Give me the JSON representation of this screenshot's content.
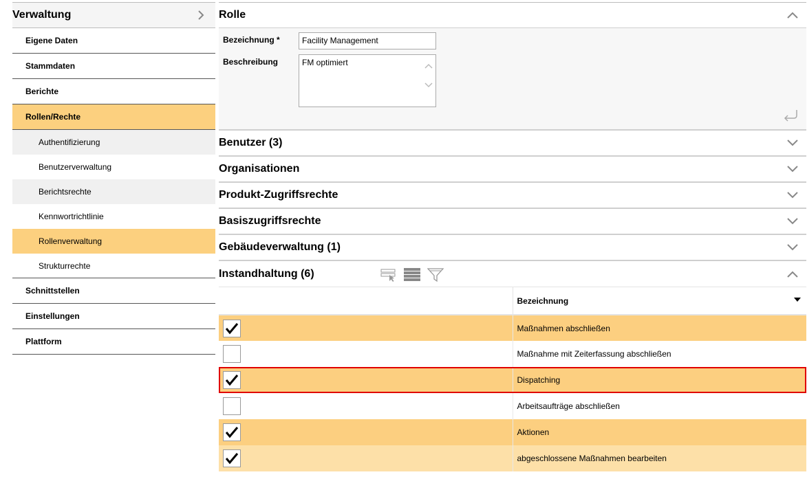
{
  "sidebar": {
    "title": "Verwaltung",
    "items": [
      {
        "label": "Eigene Daten"
      },
      {
        "label": "Stammdaten"
      },
      {
        "label": "Berichte"
      },
      {
        "label": "Rollen/Rechte"
      }
    ],
    "sub_items": [
      {
        "label": "Authentifizierung"
      },
      {
        "label": "Benutzerverwaltung"
      },
      {
        "label": "Berichtsrechte"
      },
      {
        "label": "Kennwortrichtlinie"
      },
      {
        "label": "Rollenverwaltung"
      },
      {
        "label": "Strukturrechte"
      }
    ],
    "items_after": [
      {
        "label": "Schnittstellen"
      },
      {
        "label": "Einstellungen"
      },
      {
        "label": "Plattform"
      }
    ]
  },
  "rolle": {
    "title": "Rolle",
    "bezeichnung_label": "Bezeichnung *",
    "bezeichnung_value": "Facility Management",
    "beschreibung_label": "Beschreibung",
    "beschreibung_value": "FM optimiert"
  },
  "sections": [
    {
      "title": "Benutzer (3)"
    },
    {
      "title": "Organisationen"
    },
    {
      "title": "Produkt-Zugriffsrechte"
    },
    {
      "title": "Basiszugriffsrechte"
    },
    {
      "title": "Gebäudeverwaltung (1)"
    }
  ],
  "instandhaltung": {
    "title": "Instandhaltung (6)",
    "column_header": "Bezeichnung",
    "rows": [
      {
        "label": "Maßnahmen abschließen",
        "checked": true
      },
      {
        "label": "Maßnahme mit Zeiterfassung abschließen",
        "checked": false
      },
      {
        "label": "Dispatching",
        "checked": true
      },
      {
        "label": "Arbeitsaufträge abschließen",
        "checked": false
      },
      {
        "label": "Aktionen",
        "checked": true
      },
      {
        "label": "abgeschlossene Maßnahmen bearbeiten",
        "checked": true
      }
    ]
  }
}
